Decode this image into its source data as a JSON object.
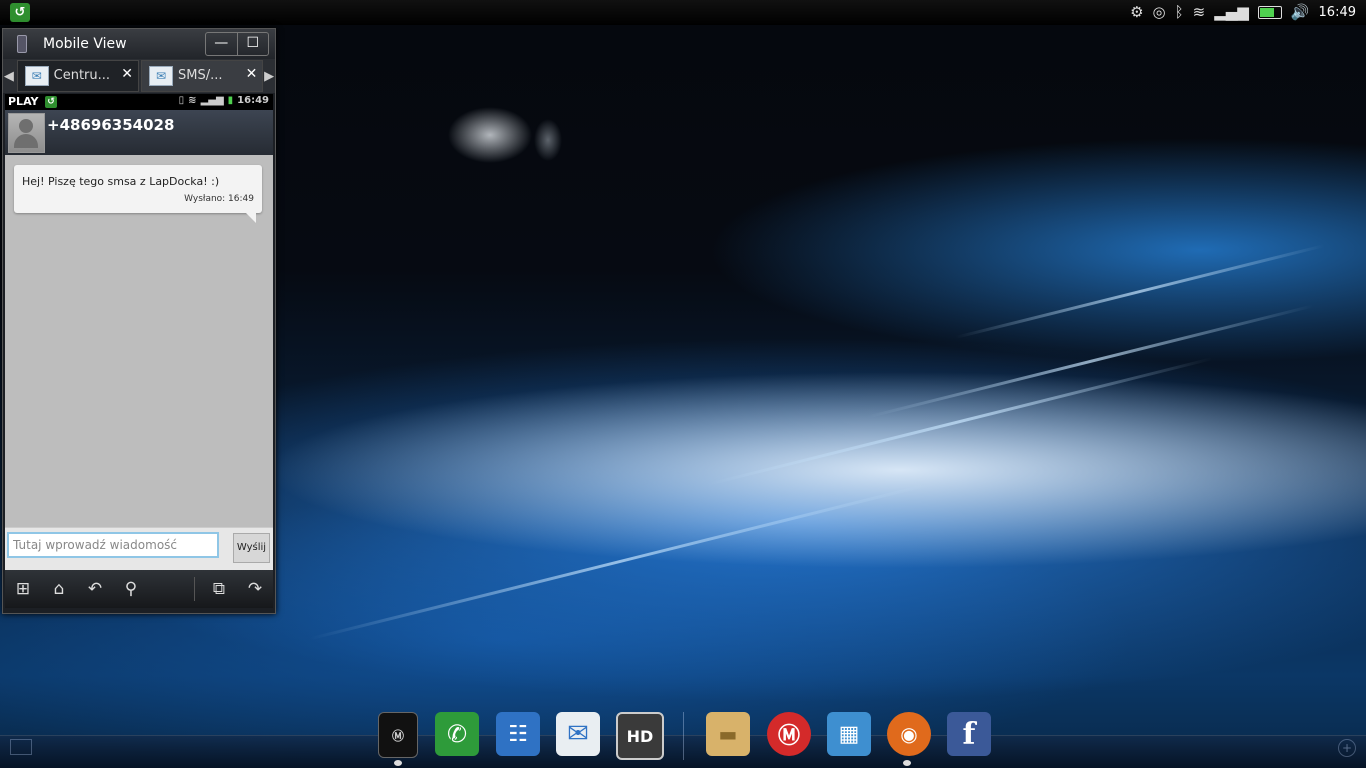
{
  "system_bar": {
    "time": "16:49",
    "icons": [
      "app-badge-icon",
      "settings-gear-icon",
      "gps-icon",
      "bluetooth-icon",
      "wifi-icon",
      "signal-icon",
      "battery-icon",
      "volume-icon"
    ]
  },
  "mobile_view": {
    "title": "Mobile View",
    "minimize_label": "—",
    "maximize_label": "☐",
    "tabs": [
      {
        "label": "Centru...",
        "icon": "envelope-icon",
        "active": false
      },
      {
        "label": "SMS/...",
        "icon": "envelope-icon",
        "active": true
      }
    ],
    "phone_status": {
      "carrier": "PLAY",
      "time": "16:49"
    },
    "conversation": {
      "contact_number": "+48696354028",
      "messages": [
        {
          "text": "Hej! Piszę tego smsa z LapDocka! :)",
          "status": "Wysłano: 16:49"
        }
      ]
    },
    "compose": {
      "placeholder": "Tutaj wprowadź wiadomość",
      "send_label": "Wyślij"
    },
    "nav_icons": [
      "apps-grid-icon",
      "home-icon",
      "back-icon",
      "search-icon",
      "screenshot-icon",
      "rotate-icon"
    ]
  },
  "dock": {
    "items": [
      {
        "name": "mobile-view",
        "icon": "phone-icon",
        "color": "#1a1a1a"
      },
      {
        "name": "phone",
        "icon": "handset-icon",
        "color": "#2e9b3a"
      },
      {
        "name": "contacts",
        "icon": "contacts-icon",
        "color": "#2f72c4"
      },
      {
        "name": "messaging",
        "icon": "envelope-icon",
        "color": "#e9eef2"
      },
      {
        "name": "hd-video",
        "icon": "hd-icon",
        "color": "#3a3a3a",
        "text": "HD"
      },
      {
        "name": "files",
        "icon": "folder-icon",
        "color": "#d8b26a"
      },
      {
        "name": "motorola",
        "icon": "motorola-icon",
        "color": "#d42a2a"
      },
      {
        "name": "media",
        "icon": "filmstrip-icon",
        "color": "#3e8fd0"
      },
      {
        "name": "firefox",
        "icon": "firefox-icon",
        "color": "#e06a1c"
      },
      {
        "name": "facebook",
        "icon": "facebook-icon",
        "color": "#3b5998",
        "text": "f"
      }
    ]
  }
}
